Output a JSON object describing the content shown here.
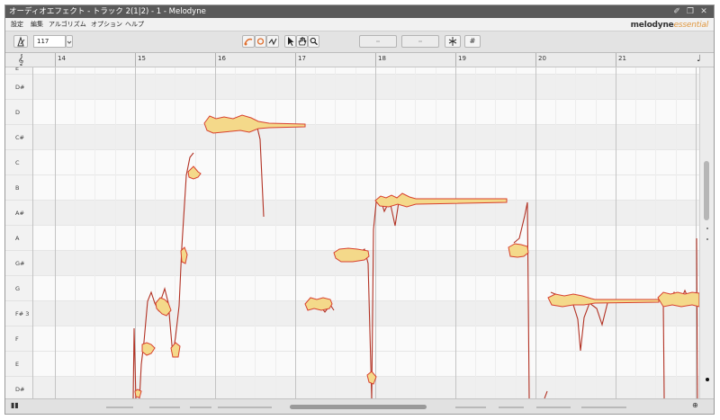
{
  "window": {
    "title": "オーディオエフェクト - トラック 2(1|2) - 1 - Melodyne",
    "pin_glyph": "✐",
    "restore_glyph": "❐",
    "close_glyph": "✕"
  },
  "menu": {
    "items": [
      "設定",
      "編集",
      "アルゴリズム",
      "オプション",
      "ヘルプ"
    ]
  },
  "logo": {
    "brand": "melodyne",
    "edition": "essential"
  },
  "toolbar": {
    "tempo_value": "117",
    "accent": "#e07030",
    "grid_glyph": "#"
  },
  "ruler": {
    "bars": [
      "14",
      "15",
      "16",
      "17",
      "18",
      "19",
      "20",
      "21"
    ]
  },
  "pitch_lanes": [
    {
      "label": "E"
    },
    {
      "label": "D#"
    },
    {
      "label": "D"
    },
    {
      "label": "C#"
    },
    {
      "label": "C"
    },
    {
      "label": "B"
    },
    {
      "label": "A#"
    },
    {
      "label": "A"
    },
    {
      "label": "G#"
    },
    {
      "label": "G"
    },
    {
      "label": "F# 3"
    },
    {
      "label": "F"
    },
    {
      "label": "E"
    },
    {
      "label": "D#"
    }
  ],
  "colors": {
    "blob_fill": "#f4d98a",
    "blob_outline": "#d8402e",
    "pitch_curve": "#b23224"
  }
}
